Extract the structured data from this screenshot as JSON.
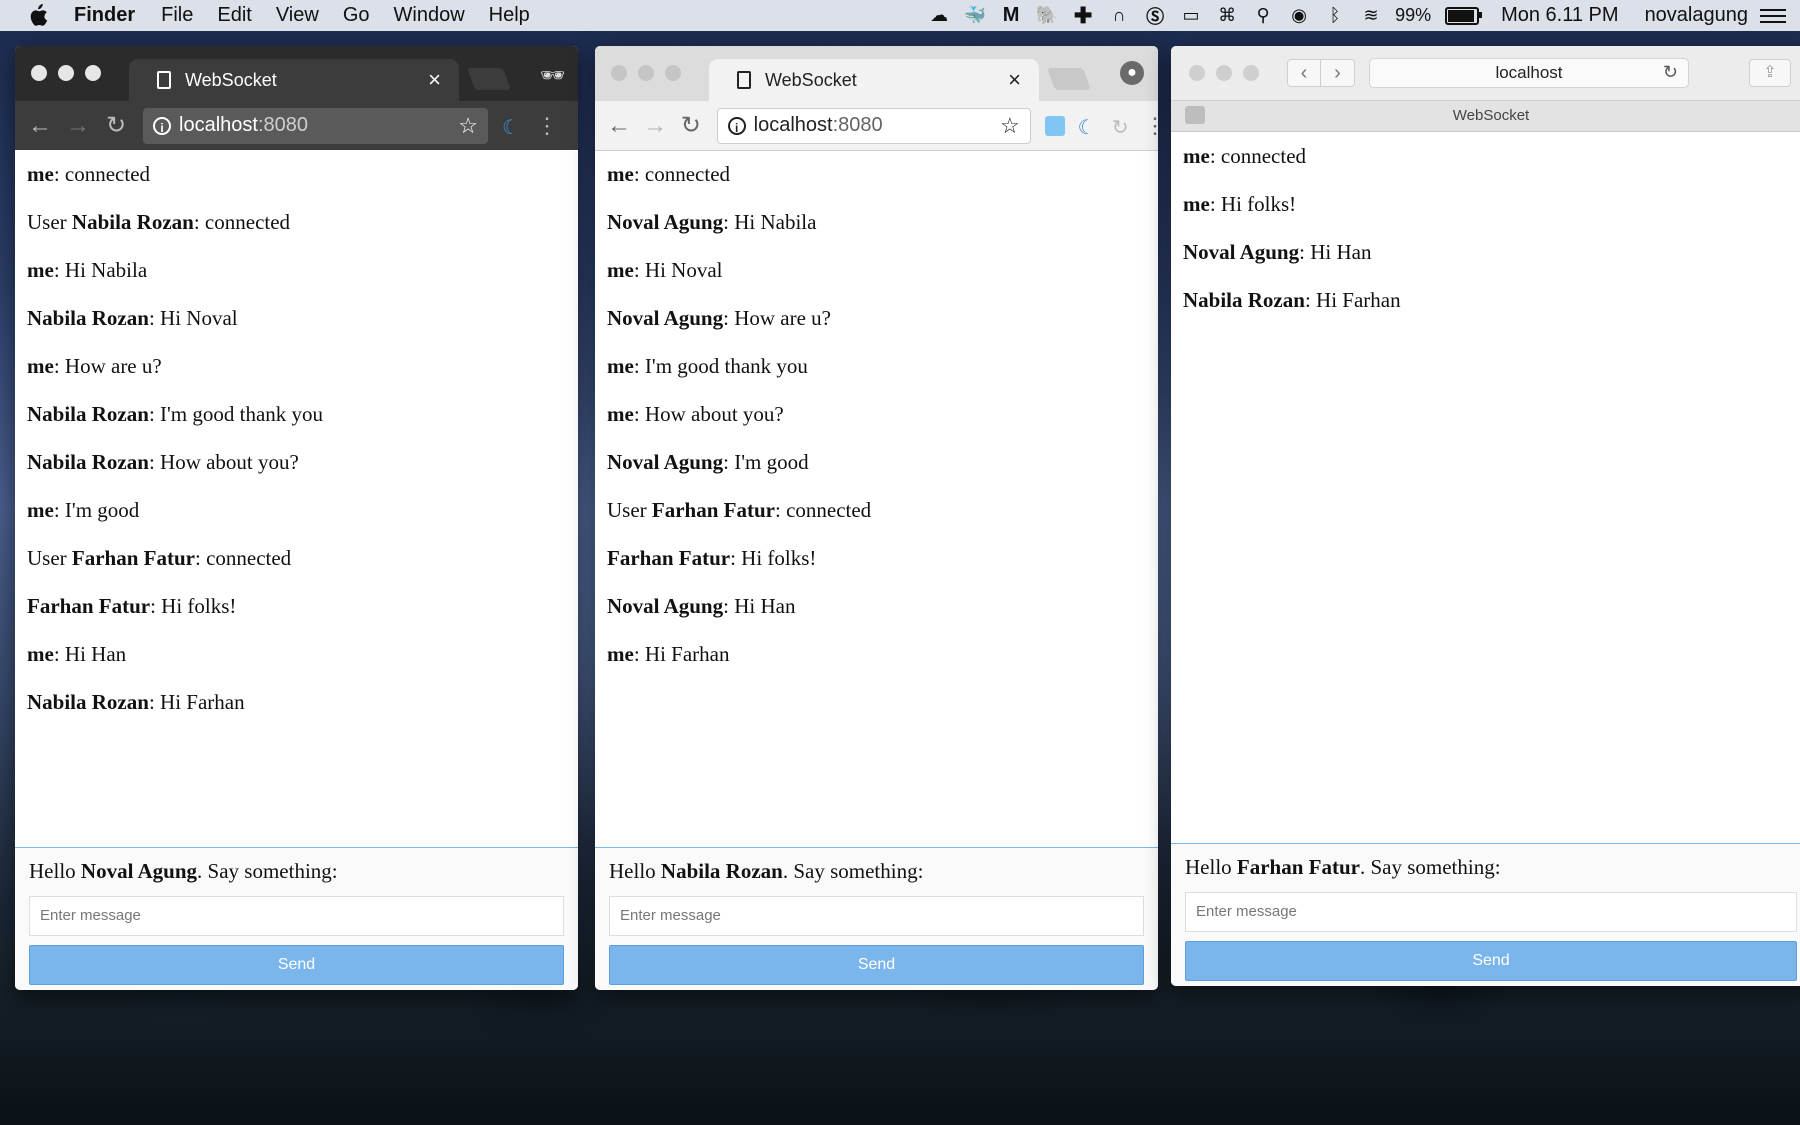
{
  "menubar": {
    "apple": "",
    "app": "Finder",
    "items": [
      "File",
      "Edit",
      "View",
      "Go",
      "Window",
      "Help"
    ],
    "battery_text": "99%",
    "battery_level": 0.99,
    "clock": "Mon 6.11 PM",
    "user": "novalagung",
    "status_icons": [
      "cloud-upload-icon",
      "docker-icon",
      "malwarebytes-icon",
      "elephant-icon",
      "plus-icon",
      "magnet-icon",
      "skype-icon",
      "display-icon",
      "keyboard-icon",
      "search-icon",
      "siri-icon",
      "bluetooth-icon",
      "wifi-icon"
    ]
  },
  "windows": [
    {
      "browser": "Chrome Incognito",
      "tab_title": "WebSocket",
      "url_host": "localhost",
      "url_port": ":8080",
      "messages": [
        {
          "prefix": "",
          "name": "me",
          "text": ": connected"
        },
        {
          "prefix": "User ",
          "name": "Nabila Rozan",
          "text": ": connected"
        },
        {
          "prefix": "",
          "name": "me",
          "text": ": Hi Nabila"
        },
        {
          "prefix": "",
          "name": "Nabila Rozan",
          "text": ": Hi Noval"
        },
        {
          "prefix": "",
          "name": "me",
          "text": ": How are u?"
        },
        {
          "prefix": "",
          "name": "Nabila Rozan",
          "text": ": I'm good thank you"
        },
        {
          "prefix": "",
          "name": "Nabila Rozan",
          "text": ": How about you?"
        },
        {
          "prefix": "",
          "name": "me",
          "text": ": I'm good"
        },
        {
          "prefix": "User ",
          "name": "Farhan Fatur",
          "text": ": connected"
        },
        {
          "prefix": "",
          "name": "Farhan Fatur",
          "text": ": Hi folks!"
        },
        {
          "prefix": "",
          "name": "me",
          "text": ": Hi Han"
        },
        {
          "prefix": "",
          "name": "Nabila Rozan",
          "text": ": Hi Farhan"
        }
      ],
      "hello_prefix": "Hello ",
      "hello_name": "Noval Agung",
      "hello_suffix": ". Say something:",
      "input_placeholder": "Enter message",
      "send_label": "Send"
    },
    {
      "browser": "Chrome",
      "tab_title": "WebSocket",
      "url_host": "localhost",
      "url_port": ":8080",
      "messages": [
        {
          "prefix": "",
          "name": "me",
          "text": ": connected"
        },
        {
          "prefix": "",
          "name": "Noval Agung",
          "text": ": Hi Nabila"
        },
        {
          "prefix": "",
          "name": "me",
          "text": ": Hi Noval"
        },
        {
          "prefix": "",
          "name": "Noval Agung",
          "text": ": How are u?"
        },
        {
          "prefix": "",
          "name": "me",
          "text": ": I'm good thank you"
        },
        {
          "prefix": "",
          "name": "me",
          "text": ": How about you?"
        },
        {
          "prefix": "",
          "name": "Noval Agung",
          "text": ": I'm good"
        },
        {
          "prefix": "User ",
          "name": "Farhan Fatur",
          "text": ": connected"
        },
        {
          "prefix": "",
          "name": "Farhan Fatur",
          "text": ": Hi folks!"
        },
        {
          "prefix": "",
          "name": "Noval Agung",
          "text": ": Hi Han"
        },
        {
          "prefix": "",
          "name": "me",
          "text": ": Hi Farhan"
        }
      ],
      "hello_prefix": "Hello ",
      "hello_name": "Nabila Rozan",
      "hello_suffix": ". Say something:",
      "input_placeholder": "Enter message",
      "send_label": "Send"
    },
    {
      "browser": "Safari",
      "address": "localhost",
      "tab_title": "WebSocket",
      "messages": [
        {
          "prefix": "",
          "name": "me",
          "text": ": connected"
        },
        {
          "prefix": "",
          "name": "me",
          "text": ": Hi folks!"
        },
        {
          "prefix": "",
          "name": "Noval Agung",
          "text": ": Hi Han"
        },
        {
          "prefix": "",
          "name": "Nabila Rozan",
          "text": ": Hi Farhan"
        }
      ],
      "hello_prefix": "Hello ",
      "hello_name": "Farhan Fatur",
      "hello_suffix": ". Say something:",
      "input_placeholder": "Enter message",
      "send_label": "Send"
    }
  ],
  "colors": {
    "send_button": "#7ab6ec",
    "divider": "#7cb6ec",
    "incognito_chrome": "#3c3c3c"
  }
}
